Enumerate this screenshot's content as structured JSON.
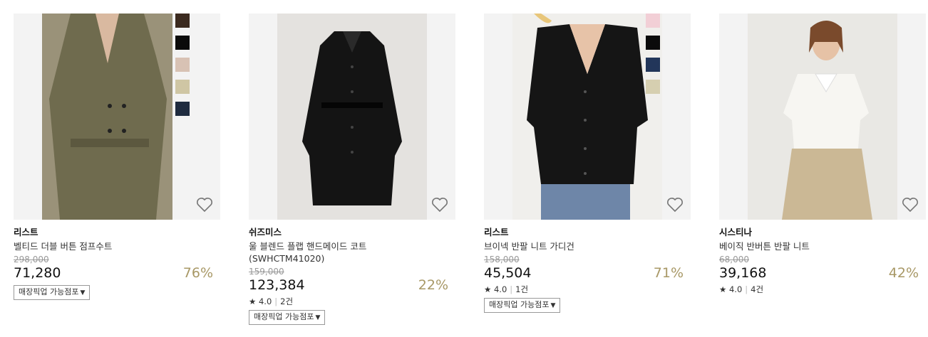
{
  "products": [
    {
      "brand": "리스트",
      "name": "벨티드 더블 버튼 점프수트",
      "original_price": "298,000",
      "price": "71,280",
      "discount": "76%",
      "pickup_label": "매장픽업 가능점포",
      "swatches": [
        "#3b2a1f",
        "#0b0b0b",
        "#d8c2b4",
        "#cfc6a4",
        "#1f2b3f"
      ],
      "photo_color": "#6f6b4e"
    },
    {
      "brand": "쉬즈미스",
      "name": "울 블렌드 플랩 핸드메이드 코트 (SWHCTM41020)",
      "original_price": "159,000",
      "price": "123,384",
      "discount": "22%",
      "rating": "4.0",
      "review_count": "2건",
      "pickup_label": "매장픽업 가능점포",
      "photo_color": "#e4e2df"
    },
    {
      "brand": "리스트",
      "name": "브이넥 반팔 니트 가디건",
      "original_price": "158,000",
      "price": "45,504",
      "discount": "71%",
      "rating": "4.0",
      "review_count": "1건",
      "pickup_label": "매장픽업 가능점포",
      "swatches": [
        "#f2cfd6",
        "#0b0b0b",
        "#22365a",
        "#d6cfb0"
      ],
      "photo_color": "#f0efec"
    },
    {
      "brand": "시스티나",
      "name": "베이직 반버튼 반팔 니트",
      "original_price": "68,000",
      "price": "39,168",
      "discount": "42%",
      "rating": "4.0",
      "review_count": "4건"
    }
  ],
  "icons": {
    "wishlist": "heart-outline-icon",
    "star": "star-icon",
    "dropdown": "caret-down-icon"
  }
}
